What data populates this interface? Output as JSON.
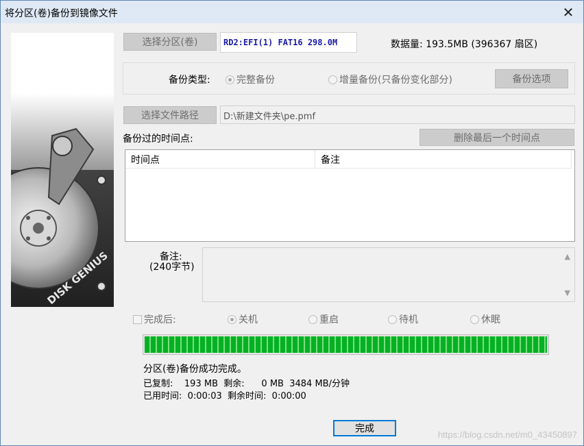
{
  "window": {
    "title": "将分区(卷)备份到镜像文件",
    "close_glyph": "✕"
  },
  "source": {
    "select_button": "选择分区(卷)",
    "partition": "RD2:EFI(1) FAT16 298.0M",
    "data_amount": "数据量: 193.5MB (396367 扇区)"
  },
  "backup_type": {
    "label": "备份类型:",
    "full": "完整备份",
    "incremental": "增量备份(只备份变化部分)",
    "options_button": "备份选项",
    "selected": "full"
  },
  "path": {
    "button": "选择文件路径",
    "value": "D:\\新建文件夹\\pe.pmf"
  },
  "timepoints": {
    "label": "备份过的时间点:",
    "delete_button": "删除最后一个时间点",
    "columns": [
      "时间点",
      "备注"
    ],
    "rows": []
  },
  "note": {
    "label": "备注:",
    "limit": "(240字节)",
    "value": ""
  },
  "after": {
    "checkbox_label": "完成后:",
    "checked": false,
    "options": [
      "关机",
      "重启",
      "待机",
      "休眠"
    ],
    "selected": "关机"
  },
  "progress": {
    "percent": 100,
    "status": "分区(卷)备份成功完成。",
    "line1": "已复制:    193 MB  剩余:      0 MB  3484 MB/分钟",
    "line2": "已用时间:  0:00:03  剩余时间:  0:00:00"
  },
  "finish_button": "完成",
  "watermark": "https://blog.csdn.net/m0_43450897",
  "colors": {
    "progress_green": "#06b025",
    "focus_border": "#0078d7",
    "partition_text": "#1a1aa6"
  }
}
